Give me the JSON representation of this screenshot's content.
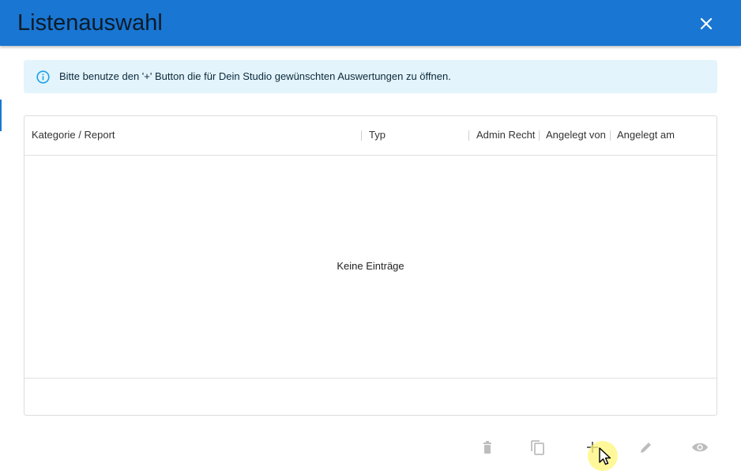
{
  "dialog": {
    "title": "Listenauswahl",
    "close_icon": "close-icon"
  },
  "info": {
    "icon": "info-icon",
    "text": "Bitte benutze den '+' Button die für Dein Studio gewünschten Auswertungen zu öffnen."
  },
  "table": {
    "columns": [
      "Kategorie / Report",
      "Typ",
      "Admin Recht",
      "Angelegt von",
      "Angelegt am"
    ],
    "empty_text": "Keine Einträge"
  },
  "toolbar": {
    "buttons": [
      "delete-icon",
      "copy-icon",
      "add-icon",
      "edit-icon",
      "view-icon"
    ]
  },
  "colors": {
    "titlebar": "#1976d2",
    "info_bg": "#e3f4fc",
    "info_icon": "#1aa0e8",
    "disabled_icon": "#bdbdbd",
    "active_icon": "#555555"
  }
}
